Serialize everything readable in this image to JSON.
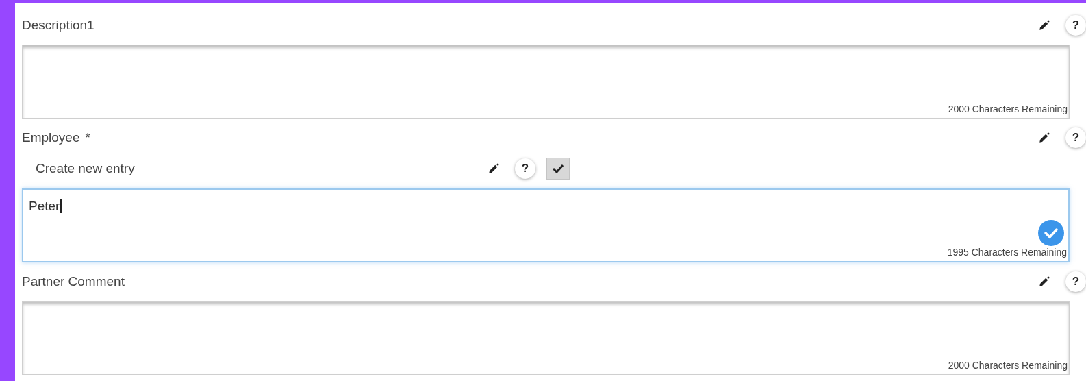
{
  "fields": [
    {
      "label": "Description1",
      "help": "?",
      "focused": false,
      "confirmed": false,
      "counter": "2000 Characters Remaining"
    },
    {
      "label": "Employee",
      "required_mark": "*",
      "help": "?",
      "create_entry": {
        "label": "Create new entry",
        "help": "?",
        "checked": true
      },
      "value": "Peter",
      "focused": true,
      "confirmed": true,
      "counter": "1995 Characters Remaining"
    },
    {
      "label": "Partner Comment",
      "help": "?",
      "focused": false,
      "confirmed": false,
      "counter": "2000 Characters Remaining"
    }
  ]
}
